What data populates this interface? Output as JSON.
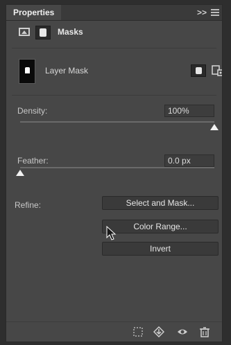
{
  "panel": {
    "title": "Properties",
    "collapse_label": ">>"
  },
  "header": {
    "label": "Masks"
  },
  "mask": {
    "label": "Layer Mask"
  },
  "density": {
    "label": "Density:",
    "value": "100%",
    "slider_fraction": 1.0
  },
  "feather": {
    "label": "Feather:",
    "value": "0.0 px",
    "slider_fraction": 0.0
  },
  "refine": {
    "label": "Refine:",
    "buttons": [
      {
        "label": "Select and Mask..."
      },
      {
        "label": "Color Range..."
      },
      {
        "label": "Invert"
      }
    ]
  },
  "footer": {
    "icons": [
      "load-selection-icon",
      "apply-mask-icon",
      "visibility-eye-icon",
      "delete-trash-icon"
    ]
  }
}
